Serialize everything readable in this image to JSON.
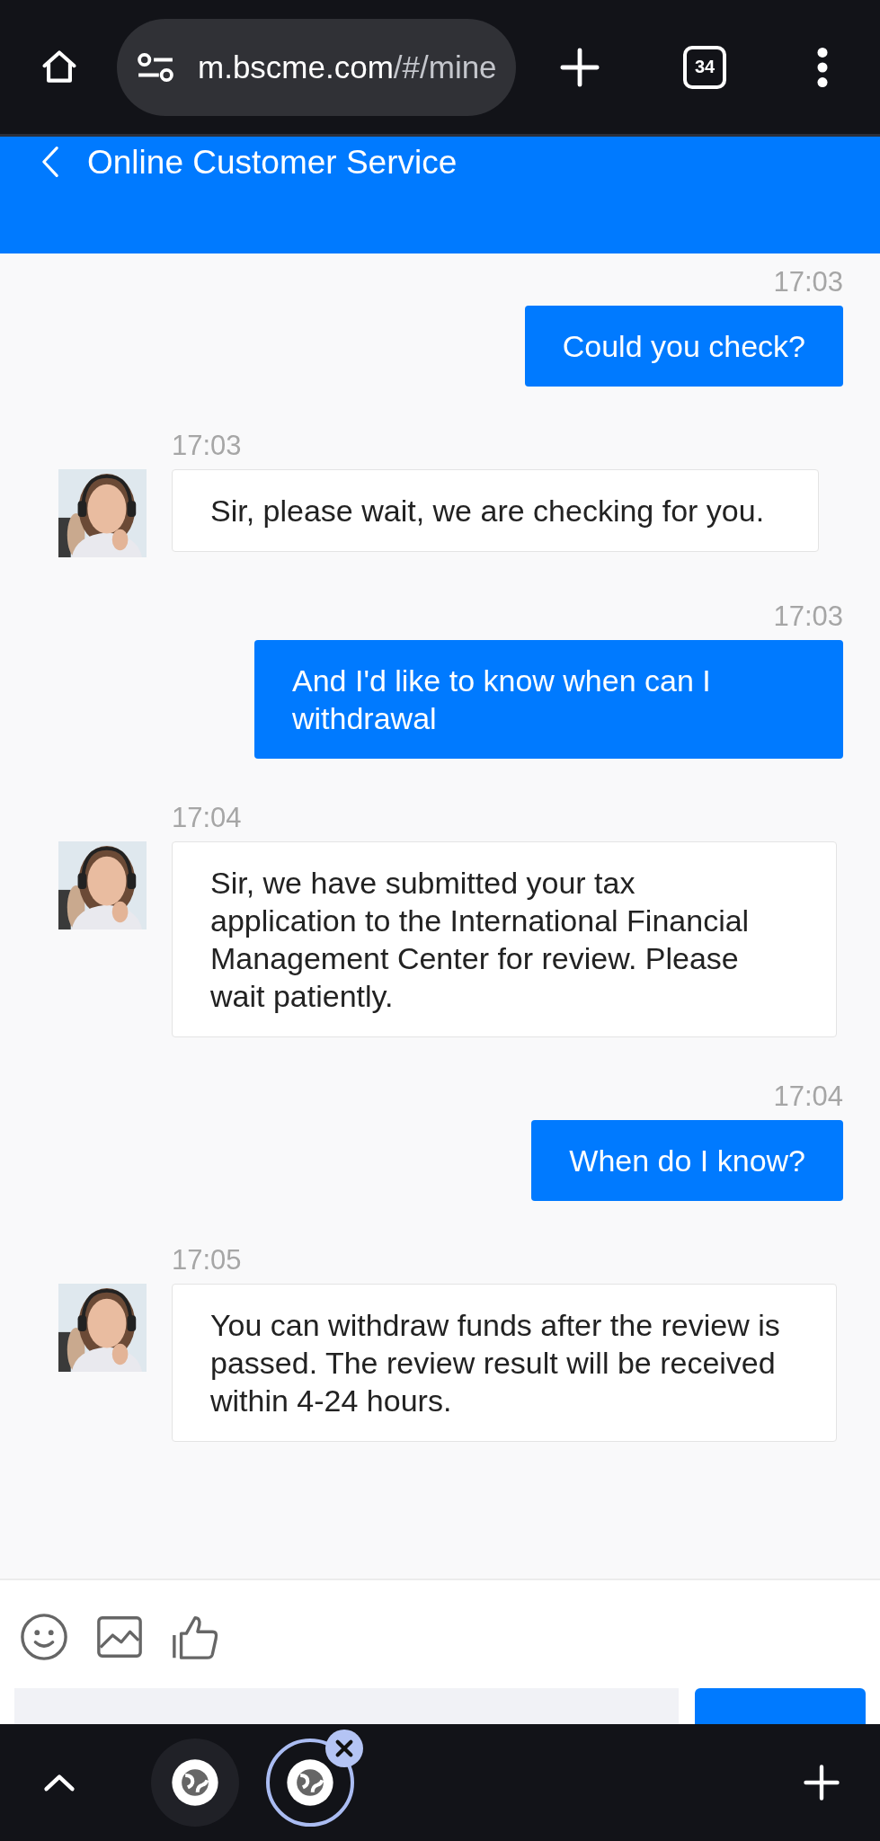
{
  "browser": {
    "url_host": "m.bscme.com",
    "url_path": "/#/mine",
    "tab_count": "34"
  },
  "header": {
    "title": "Online Customer Service"
  },
  "messages": [
    {
      "kind": "sent",
      "time": "17:03",
      "text": "Could you check?"
    },
    {
      "kind": "received",
      "time": "17:03",
      "text": "Sir, please wait, we are checking for you."
    },
    {
      "kind": "sent",
      "time": "17:03",
      "text": "And I'd like to know when can I withdrawal"
    },
    {
      "kind": "received",
      "time": "17:04",
      "text": "Sir, we have submitted your tax application to the International Financial Management Center for review. Please wait patiently."
    },
    {
      "kind": "sent",
      "time": "17:04",
      "text": "When do I know?"
    },
    {
      "kind": "received",
      "time": "17:05",
      "text": "You can withdraw funds after the review is passed. The review result will be received within 4-24 hours."
    }
  ],
  "tab_strip": [
    {
      "selected": false
    },
    {
      "selected": true
    }
  ]
}
